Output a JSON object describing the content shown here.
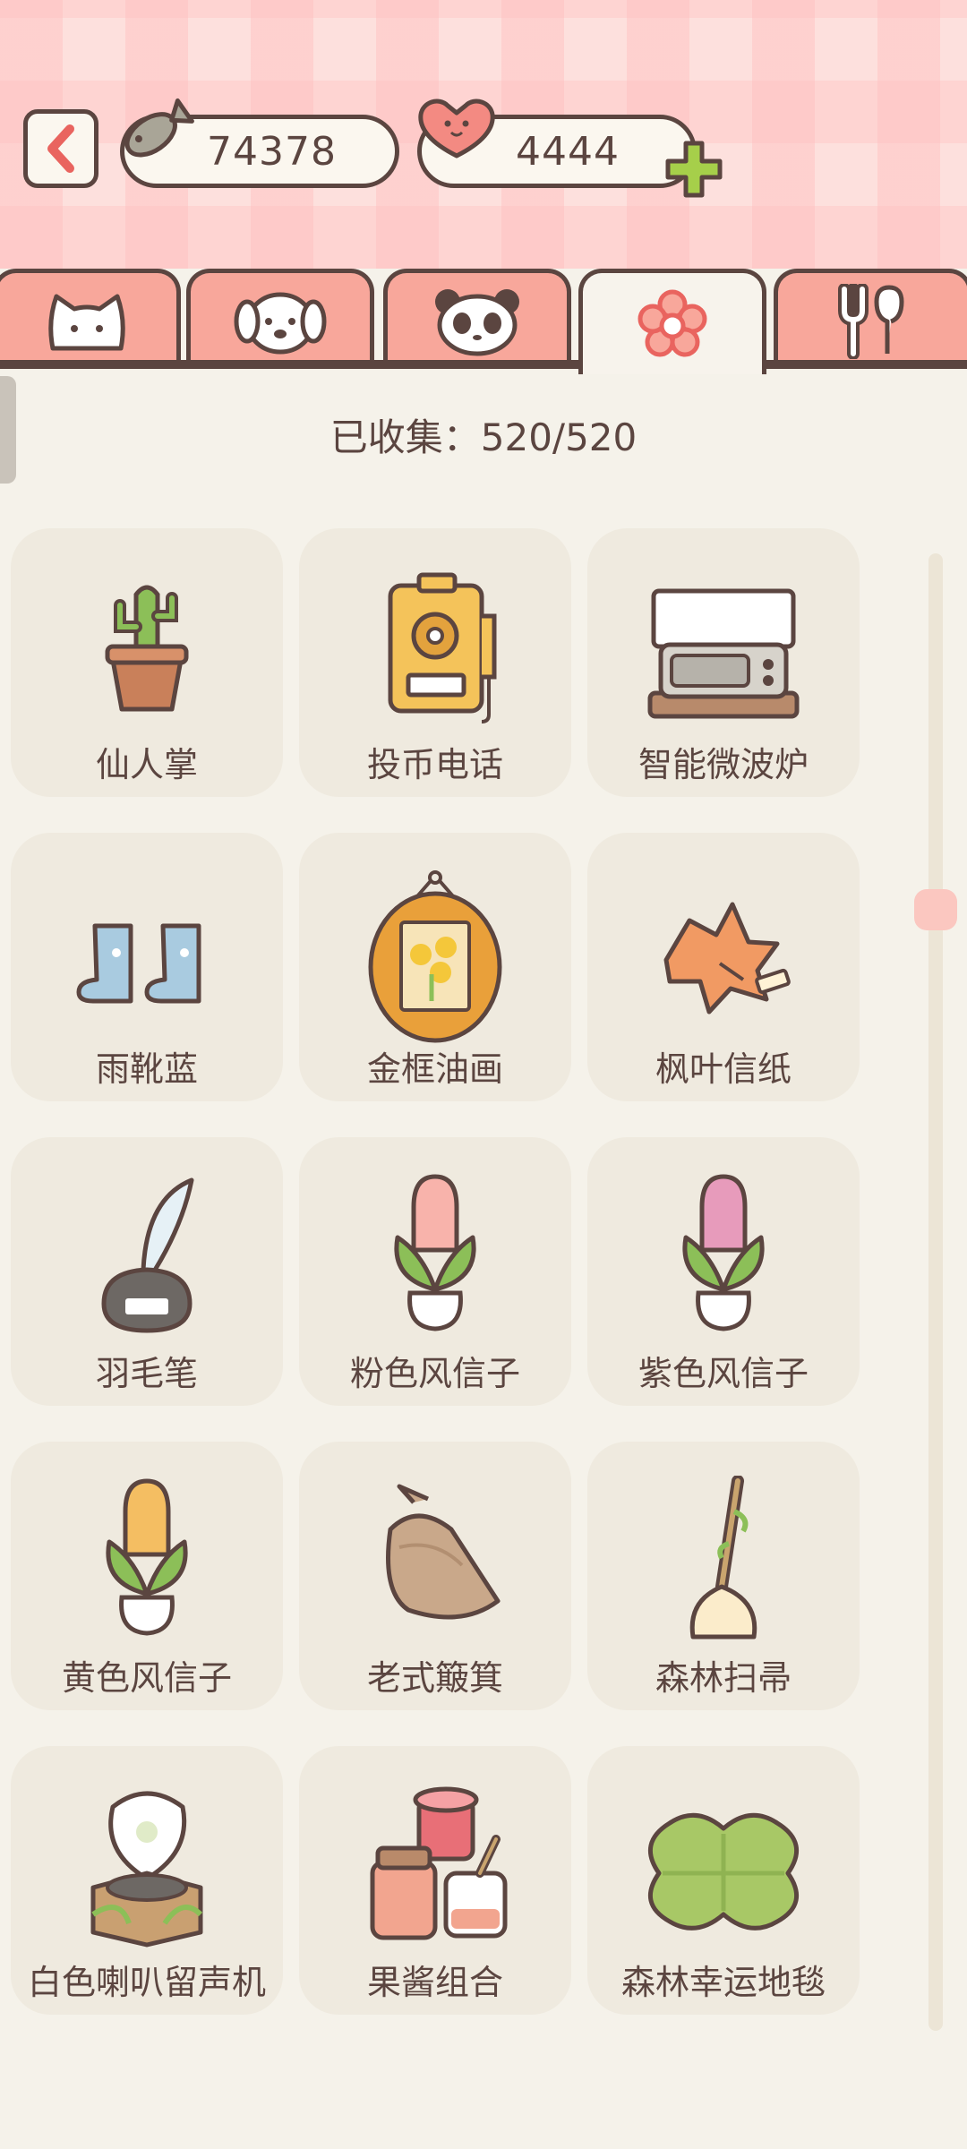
{
  "currency": {
    "fish": "74378",
    "hearts": "4444"
  },
  "tabs": [
    {
      "name": "cat-tab",
      "icon": "cat-face-icon"
    },
    {
      "name": "dog-tab",
      "icon": "dog-face-icon"
    },
    {
      "name": "panda-tab",
      "icon": "panda-face-icon"
    },
    {
      "name": "flower-tab",
      "icon": "flower-icon",
      "active": true
    },
    {
      "name": "food-tab",
      "icon": "fork-spoon-icon"
    }
  ],
  "collected_text": "已收集：520/520",
  "items": [
    {
      "label": "仙人掌",
      "icon": "cactus-icon"
    },
    {
      "label": "投币电话",
      "icon": "payphone-icon"
    },
    {
      "label": "智能微波炉",
      "icon": "microwave-icon"
    },
    {
      "label": "雨靴蓝",
      "icon": "rain-boots-icon"
    },
    {
      "label": "金框油画",
      "icon": "framed-painting-icon"
    },
    {
      "label": "枫叶信纸",
      "icon": "maple-leaf-icon"
    },
    {
      "label": "羽毛笔",
      "icon": "quill-pen-icon"
    },
    {
      "label": "粉色风信子",
      "icon": "pink-hyacinth-icon"
    },
    {
      "label": "紫色风信子",
      "icon": "purple-hyacinth-icon"
    },
    {
      "label": "黄色风信子",
      "icon": "yellow-hyacinth-icon"
    },
    {
      "label": "老式簸箕",
      "icon": "dustpan-icon"
    },
    {
      "label": "森林扫帚",
      "icon": "broom-icon"
    },
    {
      "label": "白色喇叭留声机",
      "icon": "gramophone-icon"
    },
    {
      "label": "果酱组合",
      "icon": "jam-jars-icon"
    },
    {
      "label": "森林幸运地毯",
      "icon": "clover-rug-icon"
    }
  ],
  "colors": {
    "accent": "#f8a79b",
    "outline": "#5b4540",
    "card": "#efeadf",
    "background": "#f5f2ea"
  }
}
